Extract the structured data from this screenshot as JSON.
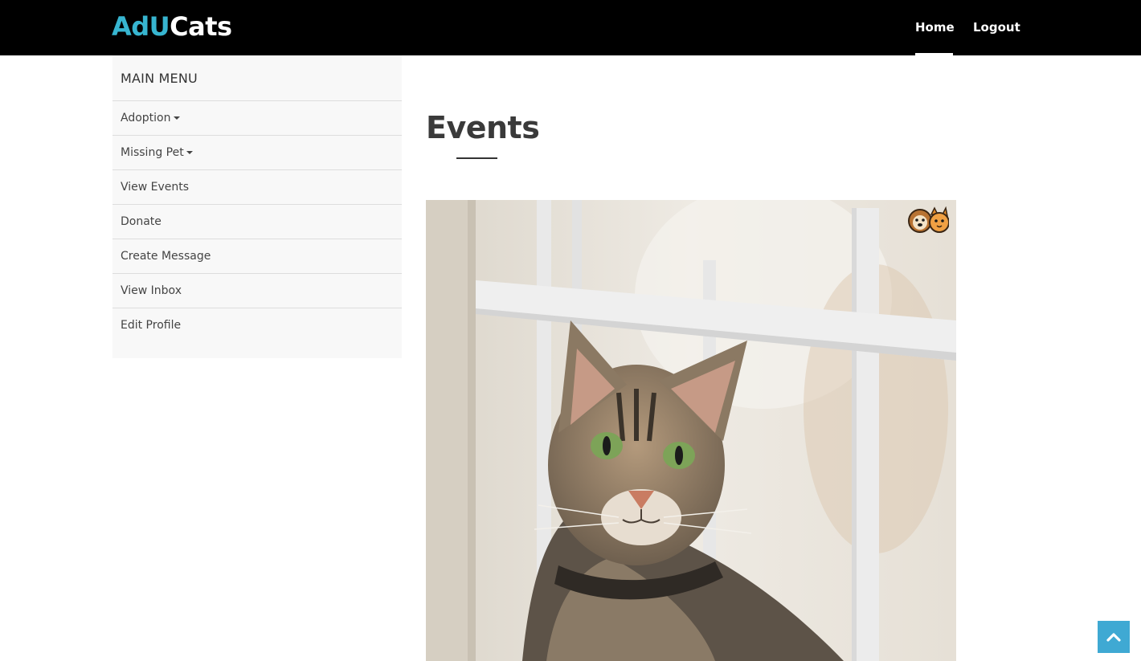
{
  "brand": {
    "part1": "AdU",
    "part2": "Cats",
    "accent": "#37b5d0"
  },
  "nav": {
    "home": "Home",
    "logout": "Logout"
  },
  "sidebar": {
    "title": "MAIN MENU",
    "items": [
      {
        "label": "Adoption",
        "dropdown": true
      },
      {
        "label": "Missing Pet",
        "dropdown": true
      },
      {
        "label": "View Events",
        "dropdown": false
      },
      {
        "label": "Donate",
        "dropdown": false
      },
      {
        "label": "Create Message",
        "dropdown": false
      },
      {
        "label": "View Inbox",
        "dropdown": false
      },
      {
        "label": "Edit Profile",
        "dropdown": false
      }
    ]
  },
  "main": {
    "title": "Events"
  },
  "icons": {
    "scroll_top": "chevron-up-icon",
    "badge": "dog-cat-logo"
  }
}
